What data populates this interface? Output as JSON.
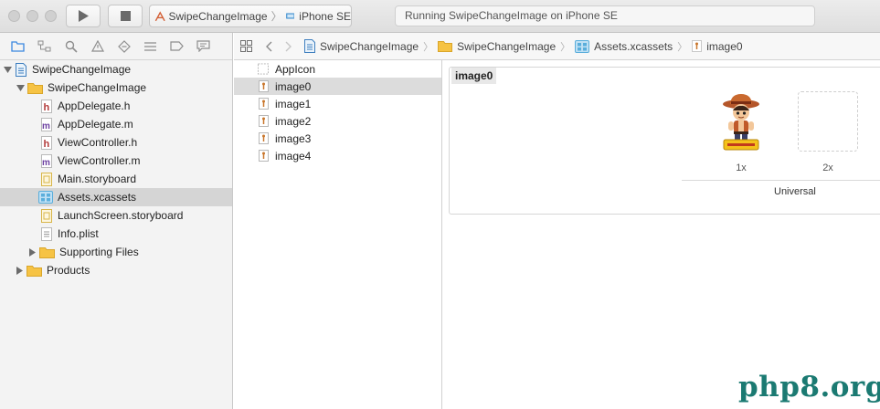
{
  "toolbar": {
    "scheme_name": "SwipeChangeImage",
    "device_name": "iPhone SE",
    "activity_text": "Running SwipeChangeImage on iPhone SE",
    "run_icon": "play-icon",
    "stop_icon": "stop-icon"
  },
  "navigator": {
    "tab_icons": [
      "folder-icon",
      "hierarchy-icon",
      "search-icon",
      "warning-icon",
      "test-icon",
      "debug-icon",
      "breakpoint-icon",
      "report-icon"
    ],
    "tree": [
      {
        "label": "SwipeChangeImage",
        "kind": "project",
        "expanded": true
      },
      {
        "label": "SwipeChangeImage",
        "kind": "folder",
        "expanded": true
      },
      {
        "label": "AppDelegate.h",
        "kind": "h"
      },
      {
        "label": "AppDelegate.m",
        "kind": "m"
      },
      {
        "label": "ViewController.h",
        "kind": "h"
      },
      {
        "label": "ViewController.m",
        "kind": "m"
      },
      {
        "label": "Main.storyboard",
        "kind": "storyboard"
      },
      {
        "label": "Assets.xcassets",
        "kind": "xcassets",
        "selected": true
      },
      {
        "label": "LaunchScreen.storyboard",
        "kind": "storyboard"
      },
      {
        "label": "Info.plist",
        "kind": "plist"
      },
      {
        "label": "Supporting Files",
        "kind": "folder",
        "expanded": false
      },
      {
        "label": "Products",
        "kind": "folder",
        "expanded": false
      }
    ]
  },
  "jumpbar": {
    "crumbs": [
      "SwipeChangeImage",
      "SwipeChangeImage",
      "Assets.xcassets",
      "image0"
    ]
  },
  "assets": {
    "items": [
      {
        "label": "AppIcon",
        "kind": "appicon"
      },
      {
        "label": "image0",
        "kind": "imageset",
        "selected": true
      },
      {
        "label": "image1",
        "kind": "imageset"
      },
      {
        "label": "image2",
        "kind": "imageset"
      },
      {
        "label": "image3",
        "kind": "imageset"
      },
      {
        "label": "image4",
        "kind": "imageset"
      }
    ]
  },
  "detail": {
    "set_name": "image0",
    "slot_1x_label": "1x",
    "slot_2x_label": "2x",
    "universal_label": "Universal"
  },
  "watermark": "php8.org",
  "colors": {
    "selection": "#d5d5d5",
    "folder": "#f6c344",
    "header_h": "#b23a3a",
    "header_m": "#6b3fa0",
    "xcassets": "#5aaedb",
    "watermark": "#1b7a72"
  }
}
